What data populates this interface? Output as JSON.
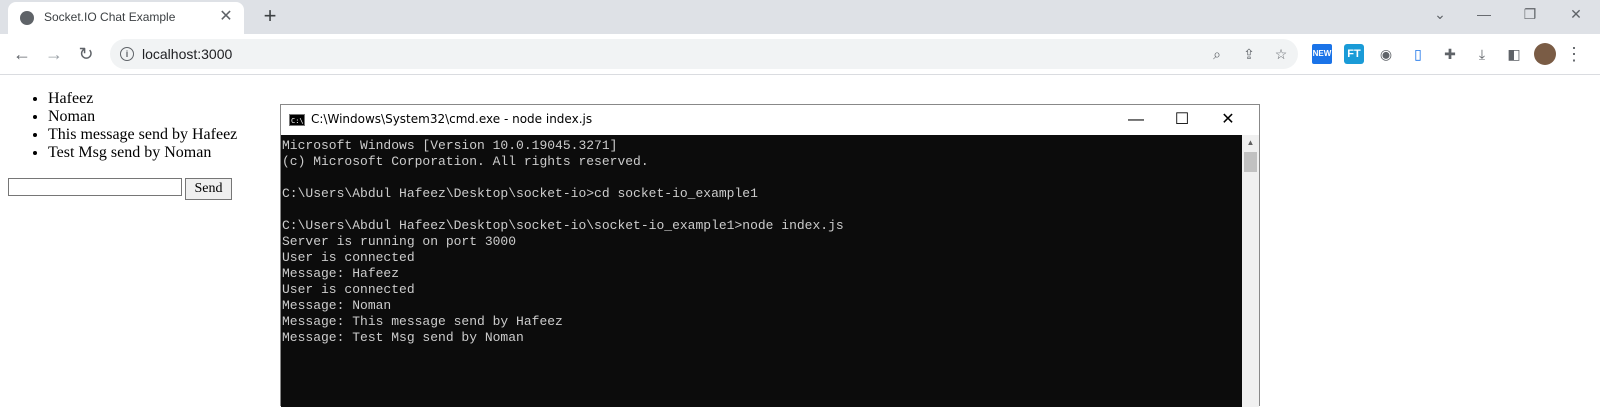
{
  "browser": {
    "tab_title": "Socket.IO Chat Example",
    "tab_close": "✕",
    "new_tab": "+",
    "window_controls": {
      "dropdown": "⌄",
      "minimize": "—",
      "restore": "❐",
      "close": "✕"
    },
    "nav": {
      "back": "←",
      "forward": "→",
      "reload": "↻"
    },
    "url": "localhost:3000",
    "menu": "⋮",
    "icons": [
      "search-icon",
      "share-icon",
      "star-icon",
      "news-extension-icon",
      "ft-extension-icon",
      "camera-icon",
      "document-extension-icon",
      "puzzle-icon",
      "download-icon",
      "sidepanel-icon",
      "avatar"
    ]
  },
  "page": {
    "messages": [
      "Hafeez",
      "Noman",
      "This message send by Hafeez",
      "Test Msg send by Noman"
    ],
    "input_value": "",
    "send_label": "Send"
  },
  "cmd": {
    "title": "C:\\Windows\\System32\\cmd.exe - node  index.js",
    "icon_text": "C:\\",
    "controls": {
      "minimize": "—",
      "maximize": "☐",
      "close": "✕"
    },
    "lines": [
      "Microsoft Windows [Version 10.0.19045.3271]",
      "(c) Microsoft Corporation. All rights reserved.",
      "",
      "C:\\Users\\Abdul Hafeez\\Desktop\\socket-io>cd socket-io_example1",
      "",
      "C:\\Users\\Abdul Hafeez\\Desktop\\socket-io\\socket-io_example1>node index.js",
      "Server is running on port 3000",
      "User is connected",
      "Message: Hafeez",
      "User is connected",
      "Message: Noman",
      "Message: This message send by Hafeez",
      "Message: Test Msg send by Noman"
    ]
  }
}
